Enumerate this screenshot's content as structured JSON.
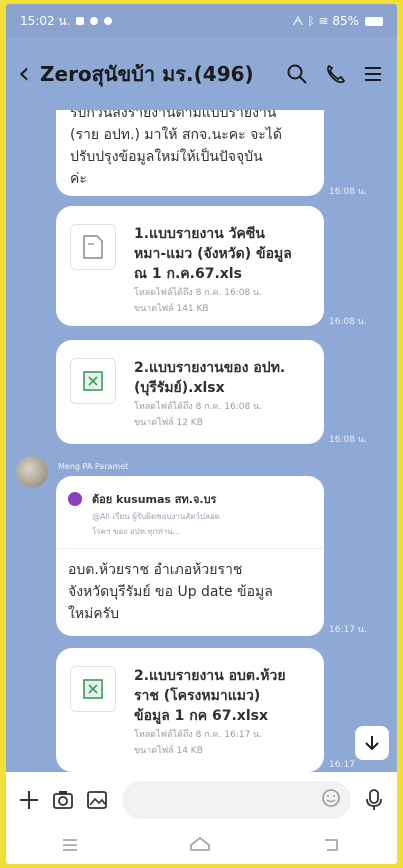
{
  "status": {
    "time": "15:02 น.",
    "right": "ᗅ ᛒ ≋ 85%"
  },
  "header": {
    "title": "Zeroสุนัขบ้า มร.(496)"
  },
  "messages": {
    "m1": {
      "lines": [
        "รับกวนส่งรายงานตามแบบรายงาน",
        "(ราย อปท.) มาให้ สกจ.นะคะ จะได้",
        "ปรับปรุงข้อมูลใหม่ให้เป็นปัจจุบัน",
        "ค่ะ"
      ],
      "time": "16:08 น."
    },
    "f1": {
      "name": [
        "1.แบบรายงาน วัคซีน",
        "หมา-แมว (จังหวัด) ข้อมูล",
        "ณ 1 ก.ค.67.xls"
      ],
      "meta": [
        "โหลดไฟล์ได้ถึง 8 ก.ค. 16:08 น.",
        "ขนาดไฟล์ 141 KB"
      ],
      "time": "16:08 น."
    },
    "f2": {
      "name": [
        "2.แบบรายงานของ อปท.",
        "(บุรีรัมย์).xlsx"
      ],
      "meta": [
        "โหลดไฟล์ได้ถึง 8 ก.ค. 16:08 น.",
        "ขนาดไฟล์ 12 KB"
      ],
      "time": "16:08 น."
    },
    "reply": {
      "sender": "Meng PA Paramet",
      "quote_name": "ต้อย kusumas สท.จ.บร",
      "quote_text": [
        "@All เรียน ผู้รับผิดชอบงานสัตว์ปลอด",
        "โรคฯ ของ อปท.ทุกท่าน..."
      ],
      "lines": [
        "อบต.ห้วยราช อำเภอห้วยราช",
        "จังหวัดบุรีรัมย์ ขอ Up date ข้อมูล",
        "ใหม่ครับ"
      ],
      "time": "16:17 น."
    },
    "f3": {
      "name": [
        "2.แบบรายงาน อบต.ห้วย",
        "ราช (โครงหมาแมว)",
        "ข้อมูล 1 กค 67.xlsx"
      ],
      "meta": [
        "โหลดไฟล์ได้ถึง 8 ก.ค. 16:17 น.",
        "ขนาดไฟล์ 14 KB"
      ],
      "time": "16:17"
    }
  }
}
